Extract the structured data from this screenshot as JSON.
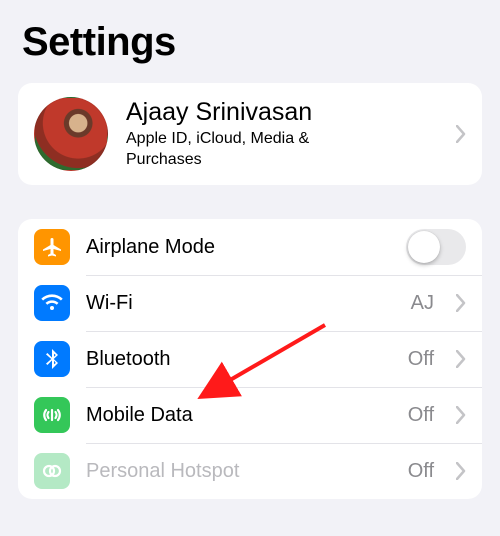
{
  "title": "Settings",
  "profile": {
    "name": "Ajaay Srinivasan",
    "subtitle": "Apple ID, iCloud, Media & Purchases"
  },
  "rows": {
    "airplane": {
      "label": "Airplane Mode",
      "on": false
    },
    "wifi": {
      "label": "Wi-Fi",
      "value": "AJ"
    },
    "bluetooth": {
      "label": "Bluetooth",
      "value": "Off"
    },
    "mobile": {
      "label": "Mobile Data",
      "value": "Off"
    },
    "hotspot": {
      "label": "Personal Hotspot",
      "value": "Off"
    }
  },
  "colors": {
    "orange": "#ff9500",
    "blue": "#007aff",
    "green": "#34c759"
  }
}
